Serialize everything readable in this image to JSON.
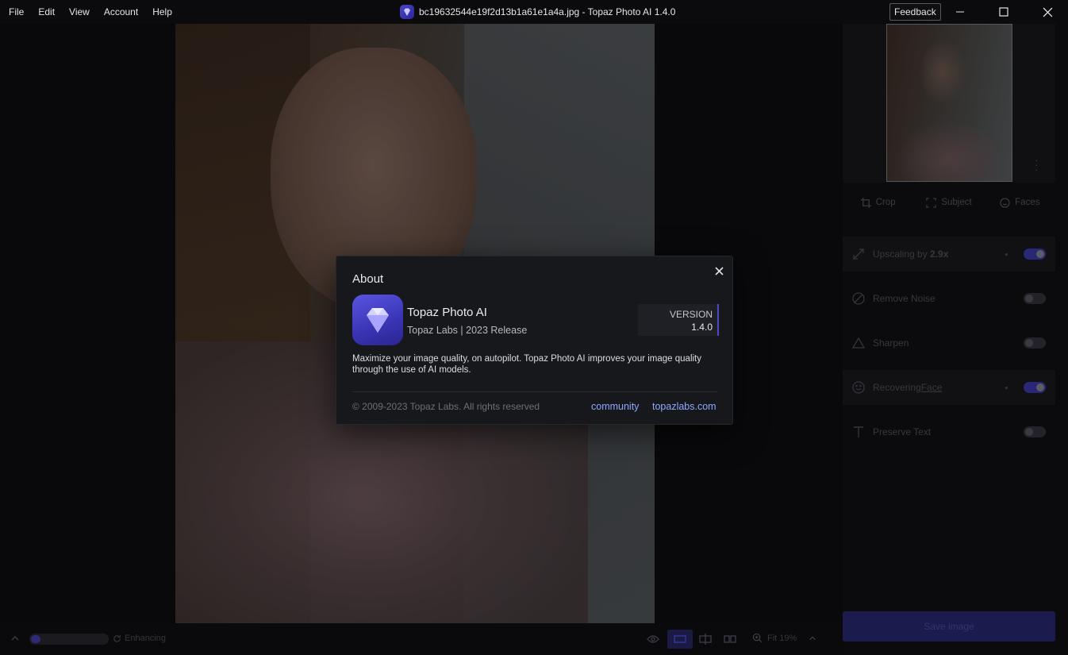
{
  "menu": [
    "File",
    "Edit",
    "View",
    "Account",
    "Help"
  ],
  "window": {
    "title": "bc19632544e19f2d13b1a61e1a4a.jpg - Topaz Photo AI 1.4.0",
    "feedback_label": "Feedback"
  },
  "right_panel": {
    "tabs": [
      {
        "label": "Crop",
        "icon": "crop-icon"
      },
      {
        "label": "Subject",
        "icon": "subject-select-icon"
      },
      {
        "label": "Faces",
        "icon": "smiley-face-icon"
      }
    ],
    "features": [
      {
        "label": "Upscaling by",
        "value": "2.9x",
        "icon": "expand-arrows-icon",
        "enabled": true
      },
      {
        "label": "Remove Noise",
        "icon": "noise-icon",
        "enabled": false
      },
      {
        "label": "Sharpen",
        "icon": "triangle-icon",
        "enabled": false
      },
      {
        "label": "Recovering",
        "value": "Face",
        "icon": "face-icon",
        "enabled": true
      },
      {
        "label": "Preserve Text",
        "icon": "text-icon",
        "enabled": false
      }
    ],
    "save_label": "Save image"
  },
  "bottom_bar": {
    "status": "Enhancing",
    "progress": 0.12,
    "zoom_label": "Fit 19%"
  },
  "about": {
    "title": "About",
    "app_name": "Topaz Photo AI",
    "company": "Topaz Labs | 2023 Release",
    "version_label": "VERSION",
    "version_value": "1.4.0",
    "description": "Maximize your image quality, on autopilot. Topaz Photo AI improves your image quality through the use of AI models.",
    "copyright": "© 2009-2023 Topaz Labs. All rights reserved",
    "link_community": "community",
    "link_site": "topazlabs.com"
  },
  "colors": {
    "accent": "#4b48c8",
    "link": "#8fa8ff",
    "modal_bg": "#17181c"
  }
}
